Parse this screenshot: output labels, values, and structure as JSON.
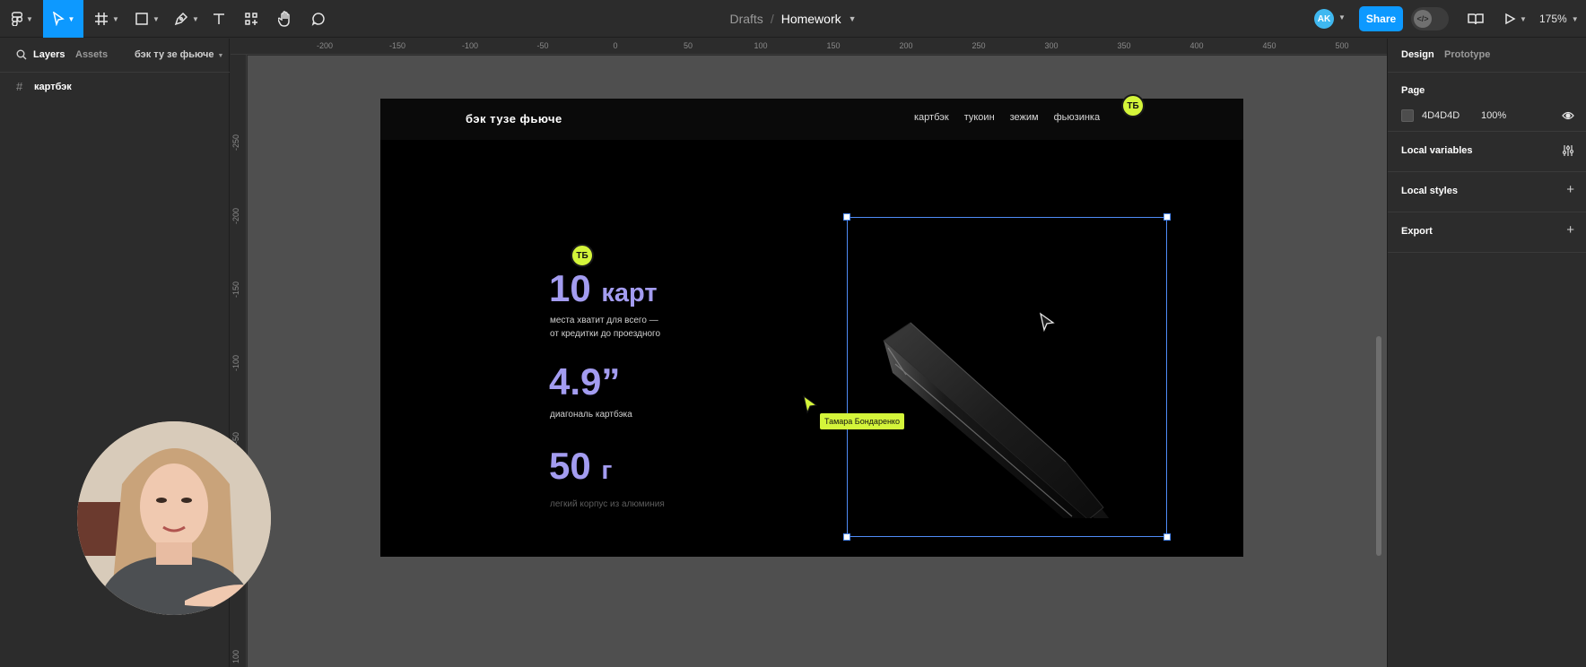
{
  "toolbar": {
    "zoom": "175%",
    "share_label": "Share",
    "avatar_initials": "AK",
    "breadcrumb": {
      "folder": "Drafts",
      "separator": "/",
      "file": "Homework"
    }
  },
  "left_panel": {
    "tabs": {
      "layers": "Layers",
      "assets": "Assets"
    },
    "page_selector": "бэк ту зе фьюче",
    "layers": [
      {
        "icon": "#",
        "label": "картбэк"
      }
    ]
  },
  "ruler": {
    "top": [
      "-200",
      "-150",
      "-100",
      "-50",
      "0",
      "50",
      "100",
      "150",
      "200",
      "250",
      "300",
      "350",
      "400",
      "450",
      "500"
    ],
    "left": [
      "-250",
      "-200",
      "-150",
      "-100",
      "-50",
      "100"
    ]
  },
  "frame": {
    "logo": "бэк тузе фьюче",
    "nav_links": [
      "картбэк",
      "тукоин",
      "зежим",
      "фьюзинка"
    ],
    "stats": [
      {
        "number": "10",
        "unit": "карт",
        "desc_line1": "места хватит для всего —",
        "desc_line2": "от кредитки до проездного"
      },
      {
        "number": "4.9”",
        "desc": "диагональ картбэка"
      },
      {
        "number": "50",
        "unit": "г",
        "desc": "легкий корпус из алюминия"
      }
    ]
  },
  "collaborators": {
    "badge": "ТБ",
    "cursor_label": "Тамара Бондаренко",
    "badge_color": "#d4f53a"
  },
  "right_panel": {
    "tabs": {
      "design": "Design",
      "prototype": "Prototype"
    },
    "page_section": {
      "title": "Page",
      "color": "4D4D4D",
      "opacity": "100%"
    },
    "sections": [
      "Local variables",
      "Local styles",
      "Export"
    ]
  },
  "colors": {
    "accent": "#0d99ff",
    "stat_purple": "#a39cf0",
    "canvas": "#4f4f4f",
    "selection": "#4f8cf7"
  }
}
